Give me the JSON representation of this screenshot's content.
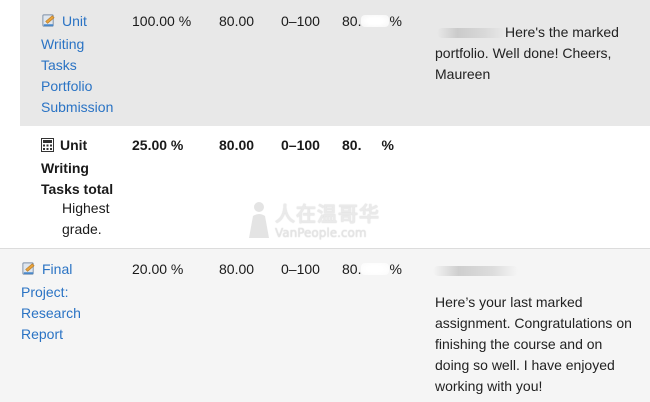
{
  "rows": [
    {
      "name_lines": [
        "Unit",
        "Writing",
        "Tasks",
        "Portfolio",
        "Submission"
      ],
      "icon": "assignment-icon",
      "weight": "100.00 %",
      "grade": "80.00",
      "range": "0–100",
      "percentage_prefix": "80.",
      "percentage_suffix": "%",
      "feedback": "Here's the marked portfolio.  Well done!  Cheers, Maureen"
    },
    {
      "name_lines": [
        "Unit",
        "Writing",
        "Tasks total"
      ],
      "sub_lines": [
        "Highest",
        "grade."
      ],
      "icon": "calculator-icon",
      "weight": "25.00 %",
      "grade": "80.00",
      "range": "0–100",
      "percentage_prefix": "80.",
      "percentage_suffix": "%"
    },
    {
      "name_lines": [
        "Final",
        "Project:",
        "Research",
        "Report"
      ],
      "icon": "assignment-icon",
      "weight": "20.00 %",
      "grade": "80.00",
      "range": "0–100",
      "percentage_prefix": "80.",
      "percentage_suffix": "%",
      "feedback": "Here’s your last marked assignment.  Congratulations on finishing the course and on doing so well.  I have enjoyed working with you!"
    }
  ],
  "watermark": {
    "title": "人在温哥华",
    "url": "VanPeople.com"
  }
}
